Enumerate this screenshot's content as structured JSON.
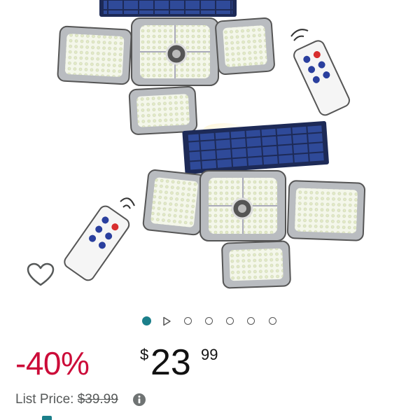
{
  "image_carousel": {
    "total_items": 7,
    "active_index": 0,
    "video_index": 1
  },
  "price": {
    "discount": "-40%",
    "currency_symbol": "$",
    "whole": "23",
    "fraction": "99"
  },
  "list_price": {
    "label": "List Price:",
    "value": "$39.99"
  },
  "icons": [
    "heart-icon",
    "play-icon",
    "info-icon"
  ],
  "colors": {
    "discount": "#cc0c39",
    "active_dot": "#1b7f8a"
  }
}
